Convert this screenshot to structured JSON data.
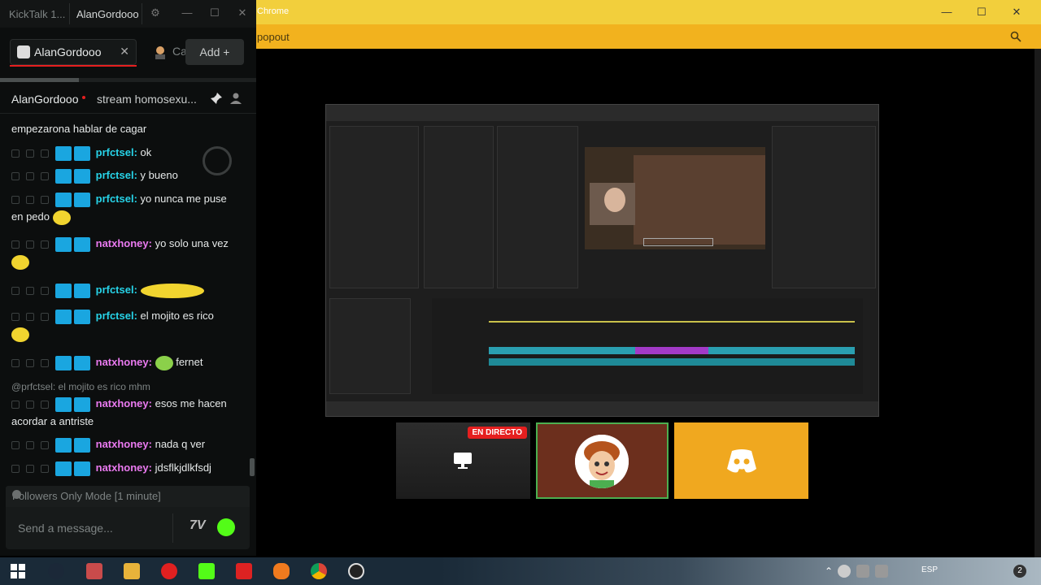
{
  "chrome": {
    "title": "Chrome",
    "url_fragment": "popout",
    "controls": {
      "minimize": "—",
      "maximize": "☐",
      "close": "✕"
    }
  },
  "tiles": {
    "live_badge": "EN DIRECTO"
  },
  "kicktalk": {
    "app_name": "KickTalk 1...",
    "account": "AlanGordooo",
    "controls": {
      "settings": "⚙",
      "minimize": "—",
      "maximize": "☐",
      "close": "✕"
    },
    "tabs": [
      {
        "label": "AlanGordooo",
        "active": true
      },
      {
        "label": "Ca",
        "active": false
      }
    ],
    "add_button": "Add  +",
    "channel": {
      "name": "AlanGordooo",
      "stream_title": "stream homosexu..."
    },
    "messages": [
      {
        "user": "",
        "text": "empezarona hablar de cagar",
        "partial": true
      },
      {
        "user": "prfctsel:",
        "text": "ok"
      },
      {
        "user": "prfctsel:",
        "text": "y bueno"
      },
      {
        "user": "prfctsel:",
        "text": "yo nunca me puse",
        "continuation": "en pedo"
      },
      {
        "user": "natxhoney:",
        "text": "yo solo una vez"
      },
      {
        "user": "prfctsel:",
        "text": ""
      },
      {
        "user": "prfctsel:",
        "text": "el mojito es rico"
      },
      {
        "user": "natxhoney:",
        "text": "fernet"
      },
      {
        "reply": "@prfctsel: el mojito es rico mhm"
      },
      {
        "user": "natxhoney:",
        "text": "esos me hacen",
        "continuation": "acordar a antriste"
      },
      {
        "user": "natxhoney:",
        "text": "nada q ver"
      },
      {
        "user": "natxhoney:",
        "text": "jdsflkjdlkfsdj"
      }
    ],
    "followers_mode": "Followers Only Mode [1 minute]",
    "input_placeholder": "Send a message...",
    "colors": {
      "accent": "#e51f1f",
      "prfctsel": "#27d3e8",
      "natxhoney": "#ea7af0",
      "kick": "#53fc18"
    }
  },
  "taskbar": {
    "lang": "ESP",
    "notifications": "2"
  }
}
